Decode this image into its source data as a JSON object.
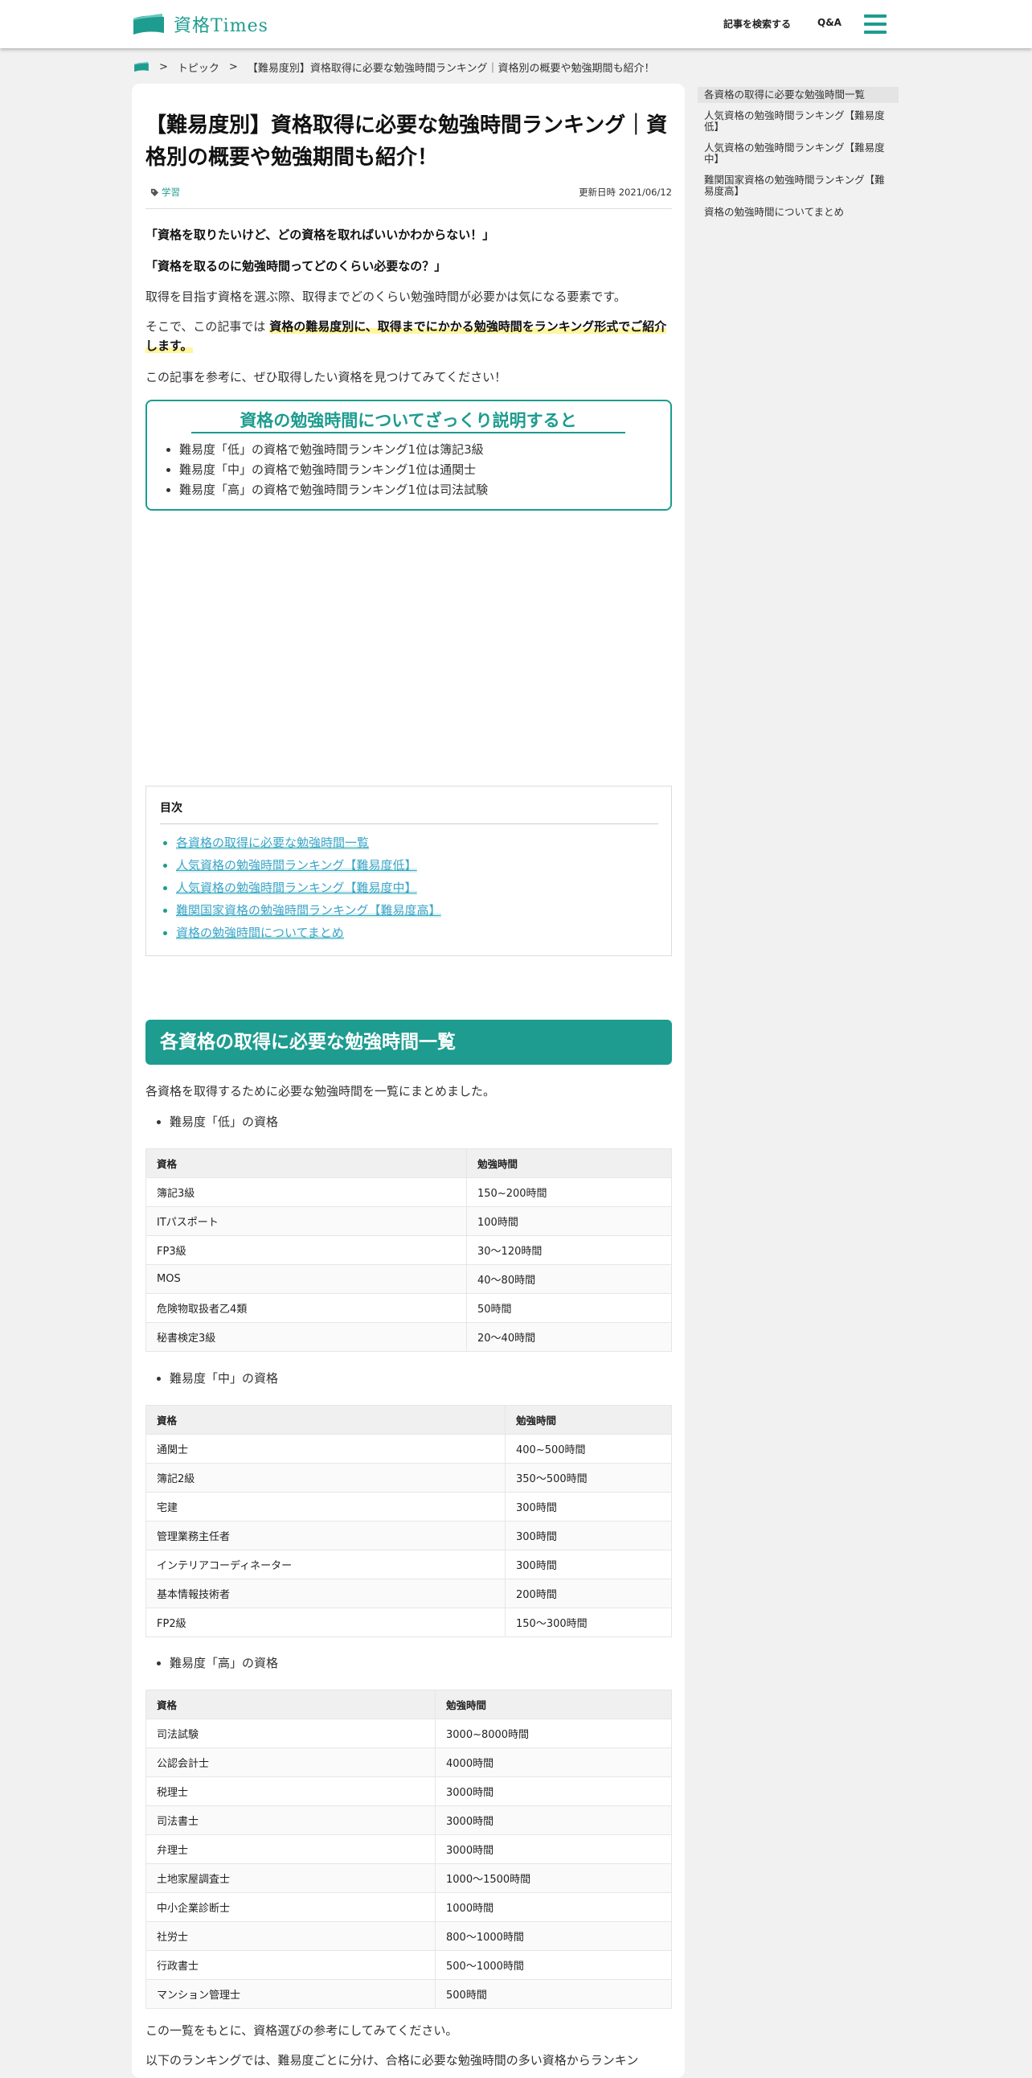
{
  "header": {
    "logo_text": "資格Times",
    "search_label": "記事を検索する",
    "qa_label": "Q&A",
    "accent_color": "#1d9c8f"
  },
  "breadcrumb": {
    "sep": ">",
    "items": [
      "トピック",
      "【難易度別】資格取得に必要な勉強時間ランキング｜資格別の概要や勉強期間も紹介！"
    ]
  },
  "article": {
    "title": "【難易度別】資格取得に必要な勉強時間ランキング｜資格別の概要や勉強期間も紹介！",
    "tag": "学習",
    "updated": "更新日時 2021/06/12",
    "intro": [
      "「資格を取りたいけど、どの資格を取ればいいかわからない！」",
      "「資格を取るのに勉強時間ってどのくらい必要なの？」",
      "取得を目指す資格を選ぶ際、取得までどのくらい勉強時間が必要かは気になる要素です。"
    ],
    "intro4_pre": "そこで、この記事では",
    "intro4_highlight": "資格の難易度別に、取得までにかかる勉強時間をランキング形式でご紹介します。",
    "intro5": "この記事を参考に、ぜひ取得したい資格を見つけてみてください！",
    "summary": {
      "title": "資格の勉強時間についてざっくり説明すると",
      "items": [
        "難易度「低」の資格で勉強時間ランキング1位は簿記3級",
        "難易度「中」の資格で勉強時間ランキング1位は通関士",
        "難易度「高」の資格で勉強時間ランキング1位は司法試験"
      ]
    },
    "toc": {
      "title": "目次",
      "items": [
        "各資格の取得に必要な勉強時間一覧",
        "人気資格の勉強時間ランキング【難易度低】",
        "人気資格の勉強時間ランキング【難易度中】",
        "難関国家資格の勉強時間ランキング【難易度高】",
        "資格の勉強時間についてまとめ"
      ]
    },
    "section1": {
      "heading": "各資格の取得に必要な勉強時間一覧",
      "lead": "各資格を取得するために必要な勉強時間を一覧にまとめました。",
      "low_label": "難易度「低」の資格",
      "mid_label": "難易度「中」の資格",
      "high_label": "難易度「高」の資格",
      "col_name": "資格",
      "col_time": "勉強時間",
      "low_rows": [
        [
          "簿記3級",
          "150~200時間"
        ],
        [
          "ITパスポート",
          "100時間"
        ],
        [
          "FP3級",
          "30〜120時間"
        ],
        [
          "MOS",
          "40〜80時間"
        ],
        [
          "危険物取扱者乙4類",
          "50時間"
        ],
        [
          "秘書検定3級",
          "20〜40時間"
        ]
      ],
      "mid_rows": [
        [
          "通関士",
          "400~500時間"
        ],
        [
          "簿記2級",
          "350〜500時間"
        ],
        [
          "宅建",
          "300時間"
        ],
        [
          "管理業務主任者",
          "300時間"
        ],
        [
          "インテリアコーディネーター",
          "300時間"
        ],
        [
          "基本情報技術者",
          "200時間"
        ],
        [
          "FP2級",
          "150〜300時間"
        ]
      ],
      "high_rows": [
        [
          "司法試験",
          "3000~8000時間"
        ],
        [
          "公認会計士",
          "4000時間"
        ],
        [
          "税理士",
          "3000時間"
        ],
        [
          "司法書士",
          "3000時間"
        ],
        [
          "弁理士",
          "3000時間"
        ],
        [
          "土地家屋調査士",
          "1000〜1500時間"
        ],
        [
          "中小企業診断士",
          "1000時間"
        ],
        [
          "社労士",
          "800〜1000時間"
        ],
        [
          "行政書士",
          "500〜1000時間"
        ],
        [
          "マンション管理士",
          "500時間"
        ]
      ],
      "after": "この一覧をもとに、資格選びの参考にしてみてください。",
      "next": "以下のランキングでは、難易度ごとに分け、合格に必要な勉強時間の多い資格からランキン"
    }
  },
  "sidebar": {
    "items": [
      "各資格の取得に必要な勉強時間一覧",
      "人気資格の勉強時間ランキング【難易度低】",
      "人気資格の勉強時間ランキング【難易度中】",
      "難関国家資格の勉強時間ランキング【難易度高】",
      "資格の勉強時間についてまとめ"
    ]
  }
}
